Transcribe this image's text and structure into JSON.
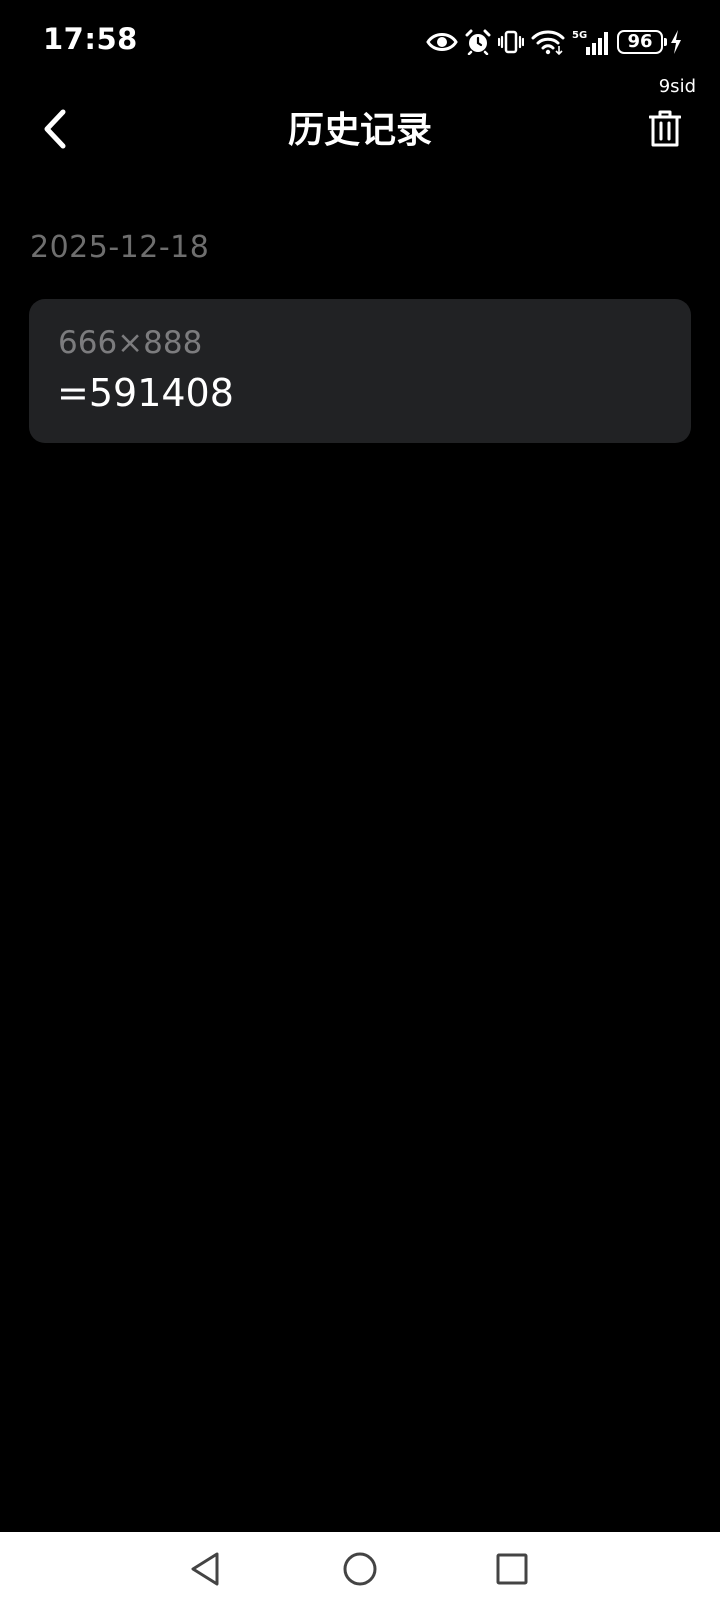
{
  "status_bar": {
    "time": "17:58",
    "battery_level": "96",
    "net_speed": "9sid",
    "signal_label": "5G",
    "icons": [
      "eye-icon",
      "alarm-icon",
      "vibrate-icon",
      "wifi-icon",
      "signal-5g-icon",
      "battery-icon",
      "charging-icon"
    ]
  },
  "header": {
    "title": "历史记录",
    "back_icon": "chevron-left-icon",
    "delete_icon": "trash-icon"
  },
  "history": {
    "groups": [
      {
        "date": "2025-12-18",
        "records": [
          {
            "expression": "666×888",
            "result": "=591408"
          }
        ]
      }
    ]
  },
  "nav_bar": {
    "icons": [
      "nav-back-icon",
      "nav-home-icon",
      "nav-recents-icon"
    ]
  },
  "colors": {
    "background": "#000000",
    "card": "#212224",
    "date_text": "#6e6e6e",
    "expression_text": "#7c7c7e",
    "primary_text": "#ffffff",
    "nav_bar": "#ffffff"
  }
}
